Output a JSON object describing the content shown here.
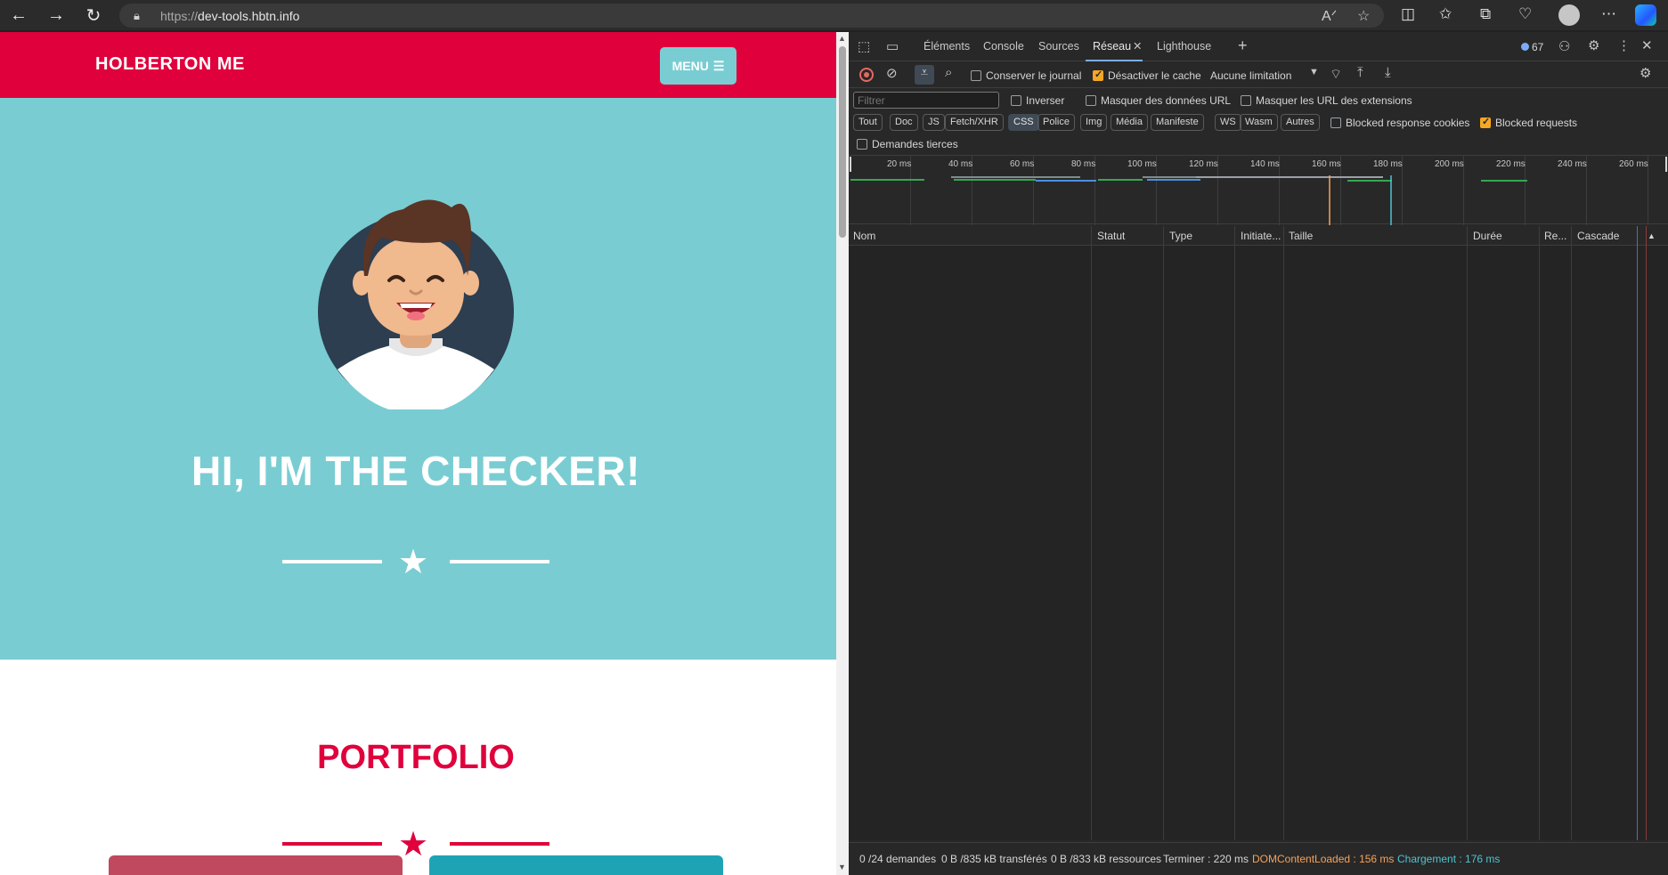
{
  "browser": {
    "url_scheme": "https://",
    "url_host": "dev-tools.hbtn.info"
  },
  "page": {
    "brand": "HOLBERTON ME",
    "menu_label": "MENU",
    "hero_title": "HI, I'M THE CHECKER!",
    "portfolio_title": "PORTFOLIO",
    "colors": {
      "primary": "#e0003c",
      "hero_bg": "#79cdd2",
      "card_1": "#c0485f",
      "card_2": "#1ea3b5"
    }
  },
  "devtools": {
    "tabs": [
      "Éléments",
      "Console",
      "Sources",
      "Réseau",
      "Lighthouse"
    ],
    "active_tab": "Réseau",
    "issues_count": "67",
    "toolbar": {
      "preserve_log": "Conserver le journal",
      "disable_cache": "Désactiver le cache",
      "throttling": "Aucune limitation"
    },
    "filter": {
      "placeholder": "Filtrer",
      "invert": "Inverser",
      "hide_data_urls": "Masquer des données URL",
      "hide_extension_urls": "Masquer les URL des extensions",
      "blocked_response_cookies": "Blocked response cookies",
      "blocked_requests": "Blocked requests",
      "third_party": "Demandes tierces"
    },
    "type_filters": [
      "Tout",
      "Doc",
      "JS",
      "Fetch/XHR",
      "CSS",
      "Police",
      "Img",
      "Média",
      "Manifeste",
      "WS",
      "Wasm",
      "Autres"
    ],
    "active_type": "CSS",
    "timeline_ticks": [
      "20 ms",
      "40 ms",
      "60 ms",
      "80 ms",
      "100 ms",
      "120 ms",
      "140 ms",
      "160 ms",
      "180 ms",
      "200 ms",
      "220 ms",
      "240 ms",
      "260 ms"
    ],
    "columns": [
      "Nom",
      "Statut",
      "Type",
      "Initiate...",
      "Taille",
      "Durée",
      "Re...",
      "Cascade"
    ],
    "status": {
      "requests": "0 /24 demandes",
      "transferred": "0 B /835 kB transférés",
      "resources": "0 B /833 kB ressources",
      "finish": "Terminer : 220 ms",
      "dom_content_loaded": "DOMContentLoaded : 156 ms",
      "load": "Chargement : 176 ms"
    },
    "colors": {
      "dcl": "#f5a35c",
      "load": "#4fc3cf",
      "accent": "#7cacf8"
    }
  }
}
